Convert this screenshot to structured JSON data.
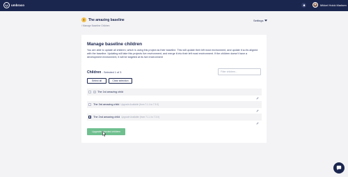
{
  "header": {
    "brand": "umbraco",
    "user_name": "Mikkel Holck Madsen",
    "logo_icon": "umbraco-logo-icon",
    "notification_icon": "bell-icon"
  },
  "project": {
    "title": "The amazing baseline",
    "badge": "!",
    "breadcrumb": "/ Manage Baseline Children",
    "settings_label": "Settings"
  },
  "card": {
    "title": "Manage baseline children",
    "description": "You are able to update all children, which is using this project as their baseline. This will update their left most environment, and update it so its aligned with the baseline. Updating will take this projects live environment, and merge it into their left most environment. If the children doesn't have a development environment, it will be targeted at its live environment"
  },
  "children": {
    "label": "Children",
    "count_text": "- Selected 1 of 3",
    "filter_placeholder": "Filter children...",
    "select_all_label": "Select all",
    "clear_selection_label": "Clear selection",
    "items": [
      {
        "name": "The 1st amazing child",
        "note": "",
        "checked": false
      },
      {
        "name": "The 3rd amazing child",
        "note": "Upgrade Available (from 7.1.1 to 7.3.0)",
        "checked": false
      },
      {
        "name": "The 2nd amazing child",
        "note": "Upgrade Available (from 7.1.1 to 7.3.0)",
        "checked": true
      }
    ]
  },
  "actions": {
    "upgrade_label": "Upgrade selected children"
  },
  "colors": {
    "navbar": "#1b264f",
    "accent_green": "#6fbf8f",
    "badge_yellow": "#f5c14a",
    "background": "#f3f3f5"
  }
}
